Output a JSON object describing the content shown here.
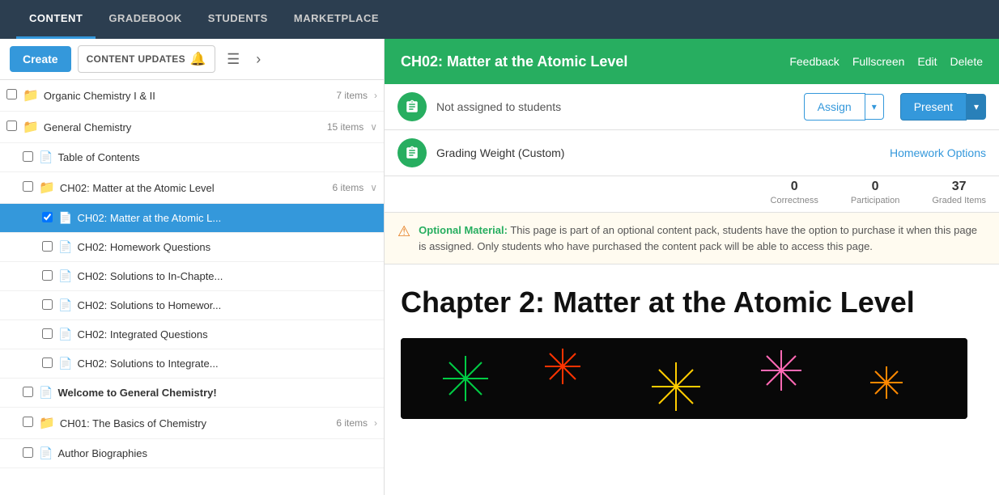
{
  "nav": {
    "items": [
      {
        "id": "content",
        "label": "CONTENT",
        "active": true
      },
      {
        "id": "gradebook",
        "label": "GRADEBOOK",
        "active": false
      },
      {
        "id": "students",
        "label": "STUDENTS",
        "active": false
      },
      {
        "id": "marketplace",
        "label": "MARKETPLACE",
        "active": false
      }
    ]
  },
  "sidebar": {
    "create_label": "Create",
    "content_updates_label": "CONTENT UPDATES",
    "items": [
      {
        "id": "organic-chem",
        "type": "folder",
        "indent": 0,
        "title": "Organic Chemistry I & II",
        "count": "7 items",
        "has_chevron": true,
        "chevron_dir": "right"
      },
      {
        "id": "general-chem",
        "type": "folder",
        "indent": 0,
        "title": "General Chemistry",
        "count": "15 items",
        "has_chevron": true,
        "chevron_dir": "down"
      },
      {
        "id": "table-of-contents",
        "type": "doc",
        "indent": 1,
        "title": "Table of Contents",
        "count": "",
        "has_chevron": false
      },
      {
        "id": "ch02-matter",
        "type": "folder",
        "indent": 1,
        "title": "CH02: Matter at the Atomic Level",
        "count": "6 items",
        "has_chevron": true,
        "chevron_dir": "down"
      },
      {
        "id": "ch02-atomic-l",
        "type": "doc",
        "indent": 2,
        "title": "CH02: Matter at the Atomic L...",
        "count": "",
        "has_chevron": false,
        "selected": true
      },
      {
        "id": "ch02-homework",
        "type": "doc",
        "indent": 2,
        "title": "CH02: Homework Questions",
        "count": "",
        "has_chevron": false
      },
      {
        "id": "ch02-solutions-in",
        "type": "doc",
        "indent": 2,
        "title": "CH02: Solutions to In-Chapte...",
        "count": "",
        "has_chevron": false
      },
      {
        "id": "ch02-solutions-hw",
        "type": "doc",
        "indent": 2,
        "title": "CH02: Solutions to Homewor...",
        "count": "",
        "has_chevron": false
      },
      {
        "id": "ch02-integrated",
        "type": "doc",
        "indent": 2,
        "title": "CH02: Integrated Questions",
        "count": "",
        "has_chevron": false
      },
      {
        "id": "ch02-solutions-int",
        "type": "doc",
        "indent": 2,
        "title": "CH02: Solutions to Integrate...",
        "count": "",
        "has_chevron": false
      },
      {
        "id": "welcome",
        "type": "doc",
        "indent": 1,
        "title": "Welcome to General Chemistry!",
        "count": "",
        "has_chevron": false
      },
      {
        "id": "ch01-basics",
        "type": "folder",
        "indent": 1,
        "title": "CH01: The Basics of Chemistry",
        "count": "6 items",
        "has_chevron": true,
        "chevron_dir": "right"
      },
      {
        "id": "author-bios",
        "type": "doc",
        "indent": 1,
        "title": "Author Biographies",
        "count": "",
        "has_chevron": false
      }
    ]
  },
  "panel": {
    "title": "CH02: Matter at the Atomic Level",
    "feedback_label": "Feedback",
    "fullscreen_label": "Fullscreen",
    "edit_label": "Edit",
    "delete_label": "Delete",
    "not_assigned_label": "Not assigned to students",
    "assign_label": "Assign",
    "present_label": "Present",
    "grading_weight_label": "Grading Weight (Custom)",
    "homework_options_label": "Homework Options",
    "stats": {
      "correctness_value": "0",
      "correctness_label": "Correctness",
      "participation_value": "0",
      "participation_label": "Participation",
      "graded_value": "37",
      "graded_label": "Graded Items"
    },
    "optional_label": "Optional Material:",
    "optional_text": "This page is part of an optional content pack, students have the option to purchase it when this page is assigned. Only students who have purchased the content pack will be able to access this page.",
    "chapter_title": "Chapter 2: Matter at the Atomic Level"
  }
}
